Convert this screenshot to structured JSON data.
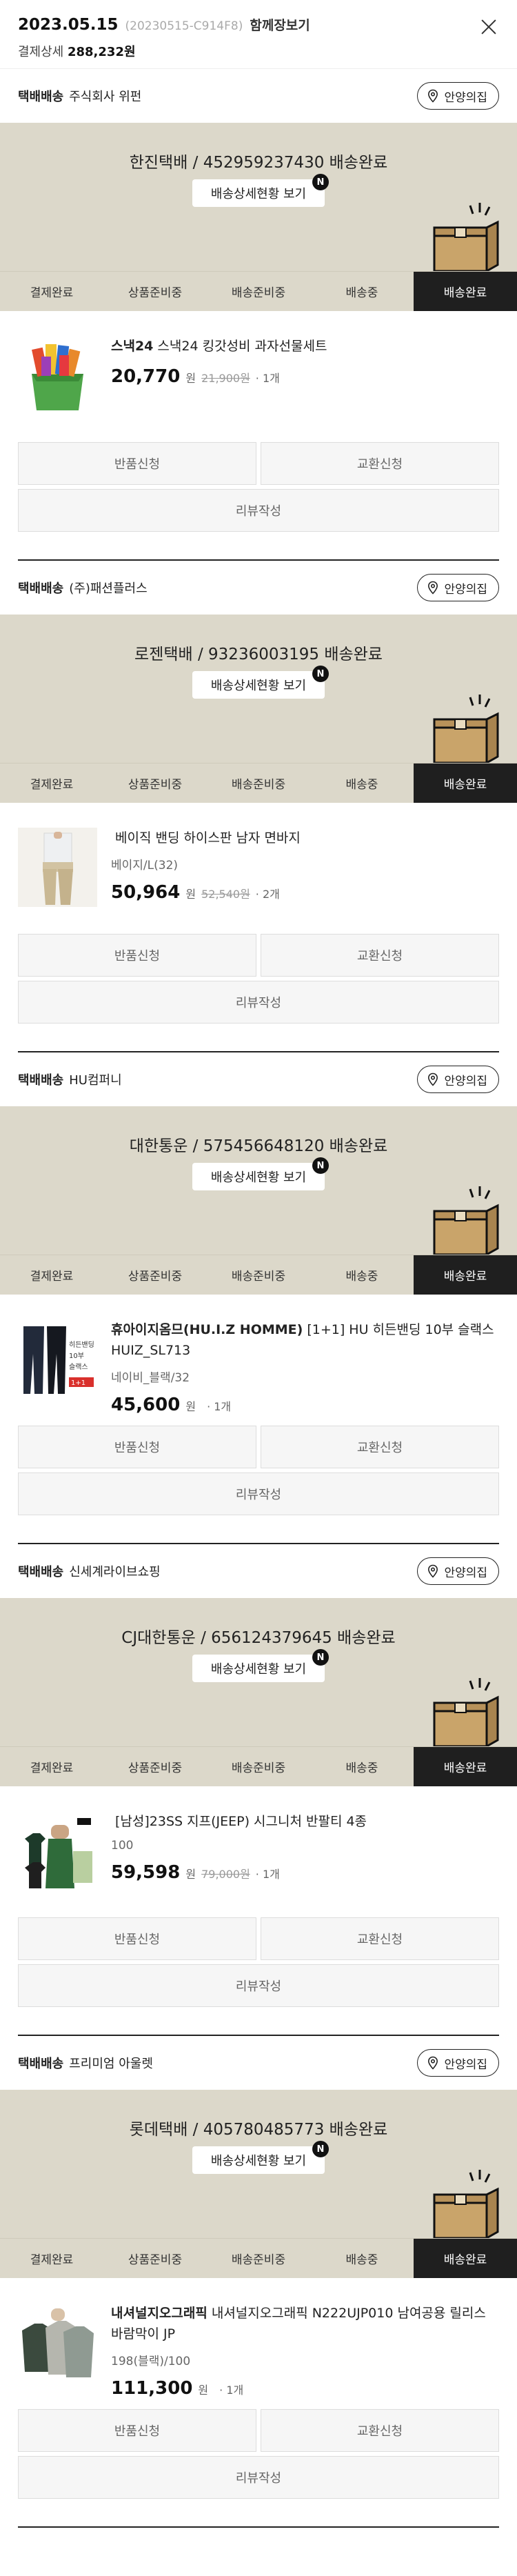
{
  "header": {
    "date": "2023.05.15",
    "order_no": "(20230515-C914F8)",
    "group_view": "함께장보기",
    "payment_label": "결제상세",
    "payment_amount": "288,232원"
  },
  "common": {
    "guide_label": "안양의집",
    "track_label": "배송상세현황 보기",
    "new_badge": "N",
    "return_label": "반품신청",
    "exchange_label": "교환신청",
    "review_label": "리뷰작성",
    "won": "원",
    "steps": [
      "결제완료",
      "상품준비중",
      "배송준비중",
      "배송중",
      "배송완료"
    ]
  },
  "shipments": [
    {
      "tag": "택배배송",
      "seller": "주식회사 위펀",
      "carrier": "한진택배 / 452959237430 배송완료",
      "product": {
        "brand": "스낵24",
        "name": "스낵24 킹갓성비 과자선물세트",
        "option": "",
        "price": "20,770",
        "orig": "21,900원",
        "qty": "· 1개"
      }
    },
    {
      "tag": "택배배송",
      "seller": "(주)패션플러스",
      "carrier": "로젠택배 / 93236003195 배송완료",
      "product": {
        "brand": "",
        "name": "베이직 밴딩 하이스판 남자 면바지",
        "option": "베이지/L(32)",
        "price": "50,964",
        "orig": "52,540원",
        "qty": "· 2개"
      }
    },
    {
      "tag": "택배배송",
      "seller": "HU컴퍼니",
      "carrier": "대한통운 / 575456648120 배송완료",
      "product": {
        "brand": "휴아이지옴므(HU.I.Z HOMME)",
        "name": "[1+1] HU 히든밴딩 10부 슬랙스 HUIZ_SL713",
        "option": "네이비_블랙/32",
        "price": "45,600",
        "orig": "",
        "qty": "· 1개"
      }
    },
    {
      "tag": "택배배송",
      "seller": "신세계라이브쇼핑",
      "carrier": "CJ대한통운 / 656124379645 배송완료",
      "product": {
        "brand": "",
        "name": "[남성]23SS 지프(JEEP) 시그니처 반팔티 4종",
        "option": "100",
        "price": "59,598",
        "orig": "79,000원",
        "qty": "· 1개"
      }
    },
    {
      "tag": "택배배송",
      "seller": "프리미엄 아울렛",
      "carrier": "롯데택배 / 405780485773 배송완료",
      "product": {
        "brand": "내셔널지오그래픽",
        "name": "내셔널지오그래픽 N222UJP010 남여공용 릴리스 바람막이 JP",
        "option": "198(블랙)/100",
        "price": "111,300",
        "orig": "",
        "qty": "· 1개"
      }
    }
  ]
}
